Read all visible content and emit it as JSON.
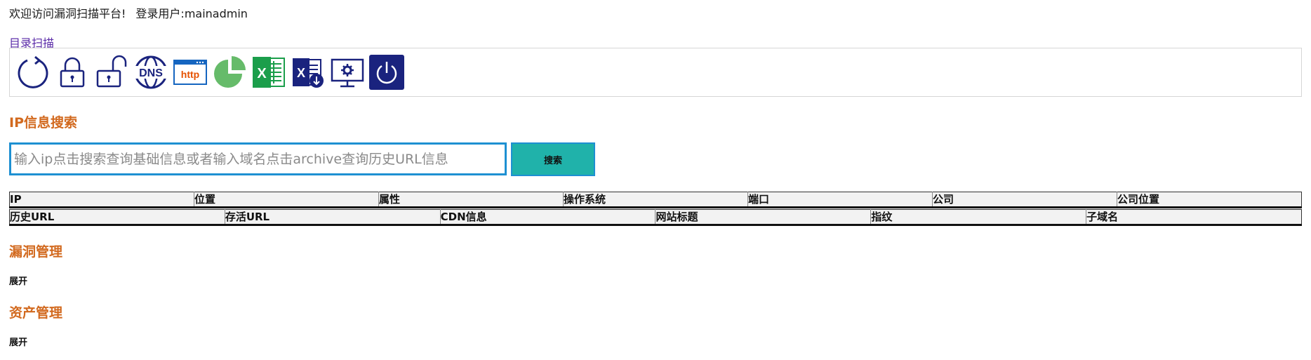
{
  "header": {
    "welcome": "欢迎访问漏洞扫描平台!",
    "user": "登录用户:mainadmin"
  },
  "nav": {
    "dir_scan_link": "目录扫描"
  },
  "toolbar": {
    "icons": [
      "refresh-icon",
      "lock-closed-icon",
      "lock-open-icon",
      "dns-icon",
      "http-icon",
      "pie-chart-icon",
      "excel-icon",
      "excel-download-icon",
      "settings-monitor-icon",
      "power-icon"
    ],
    "dns_text": "DNS",
    "http_text": "http",
    "excel_letter": "X"
  },
  "ip_search": {
    "title": "IP信息搜索",
    "placeholder": "输入ip点击搜索查询基础信息或者输入域名点击archive查询历史URL信息",
    "button": "搜索"
  },
  "table1": {
    "headers": [
      "IP",
      "位置",
      "属性",
      "操作系统",
      "端口",
      "公司",
      "公司位置"
    ]
  },
  "table2": {
    "headers": [
      "历史URL",
      "存活URL",
      "CDN信息",
      "网站标题",
      "指纹",
      "子域名"
    ]
  },
  "vuln": {
    "title": "漏洞管理",
    "toggle": "展开"
  },
  "asset": {
    "title": "资产管理",
    "toggle": "展开"
  },
  "colors": {
    "section_title": "#d2691e",
    "button_bg": "#20b2aa",
    "input_border": "#1e90d2",
    "icon_blue": "#1a237e"
  }
}
